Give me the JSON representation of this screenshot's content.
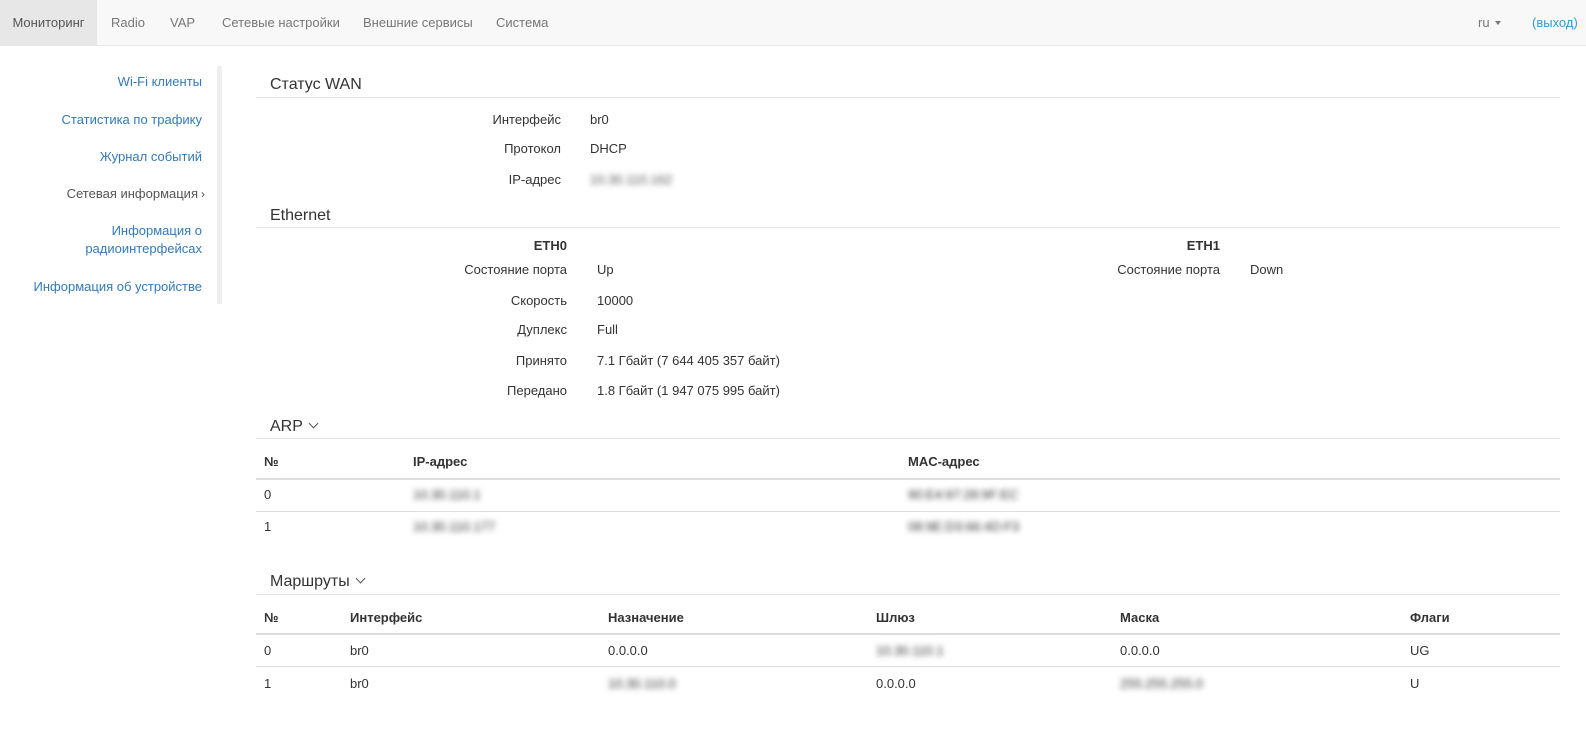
{
  "navbar": {
    "items": [
      "Мониторинг",
      "Radio",
      "VAP",
      "Сетевые настройки",
      "Внешние сервисы",
      "Система"
    ],
    "language": "ru",
    "logout": "(выход)"
  },
  "sidebar": {
    "items": [
      "Wi-Fi клиенты",
      "Статистика по трафику",
      "Журнал событий",
      "Сетевая информация",
      "Информация о",
      "радиоинтерфейсах",
      "Информация об устройстве"
    ]
  },
  "wan": {
    "title": "Статус WAN",
    "interface_label": "Интерфейс",
    "interface_value": "br0",
    "protocol_label": "Протокол",
    "protocol_value": "DHCP",
    "ip_label": "IP-адрес",
    "ip_value": "10.30.110.162"
  },
  "ethernet": {
    "title": "Ethernet",
    "eth0": {
      "header": "ETH0",
      "port_state_label": "Состояние порта",
      "port_state": "Up",
      "speed_label": "Скорость",
      "speed": "10000",
      "duplex_label": "Дуплекс",
      "duplex": "Full",
      "received_label": "Принято",
      "received": "7.1 Гбайт (7 644 405 357 байт)",
      "sent_label": "Передано",
      "sent": "1.8 Гбайт (1 947 075 995 байт)"
    },
    "eth1": {
      "header": "ETH1",
      "port_state_label": "Состояние порта",
      "port_state": "Down"
    }
  },
  "arp": {
    "title": "ARP",
    "columns": [
      "№",
      "IP-адрес",
      "MAC-адрес"
    ],
    "rows": [
      [
        "0",
        "10.30.110.1",
        "90:E4:97:28:9F:EC"
      ],
      [
        "1",
        "10.30.110.177",
        "08:9E:D3:66:4D:F3"
      ]
    ]
  },
  "routes": {
    "title": "Маршруты",
    "columns": [
      "№",
      "Интерфейс",
      "Назначение",
      "Шлюз",
      "Маска",
      "Флаги"
    ],
    "rows": [
      [
        "0",
        "br0",
        "0.0.0.0",
        "10.30.110.1",
        "0.0.0.0",
        "UG"
      ],
      [
        "1",
        "br0",
        "10.30.110.0",
        "0.0.0.0",
        "255.255.255.0",
        "U"
      ]
    ]
  },
  "icons": [
    "caret-down-icon",
    "chevron-right-icon",
    "chevron-down-icon"
  ]
}
